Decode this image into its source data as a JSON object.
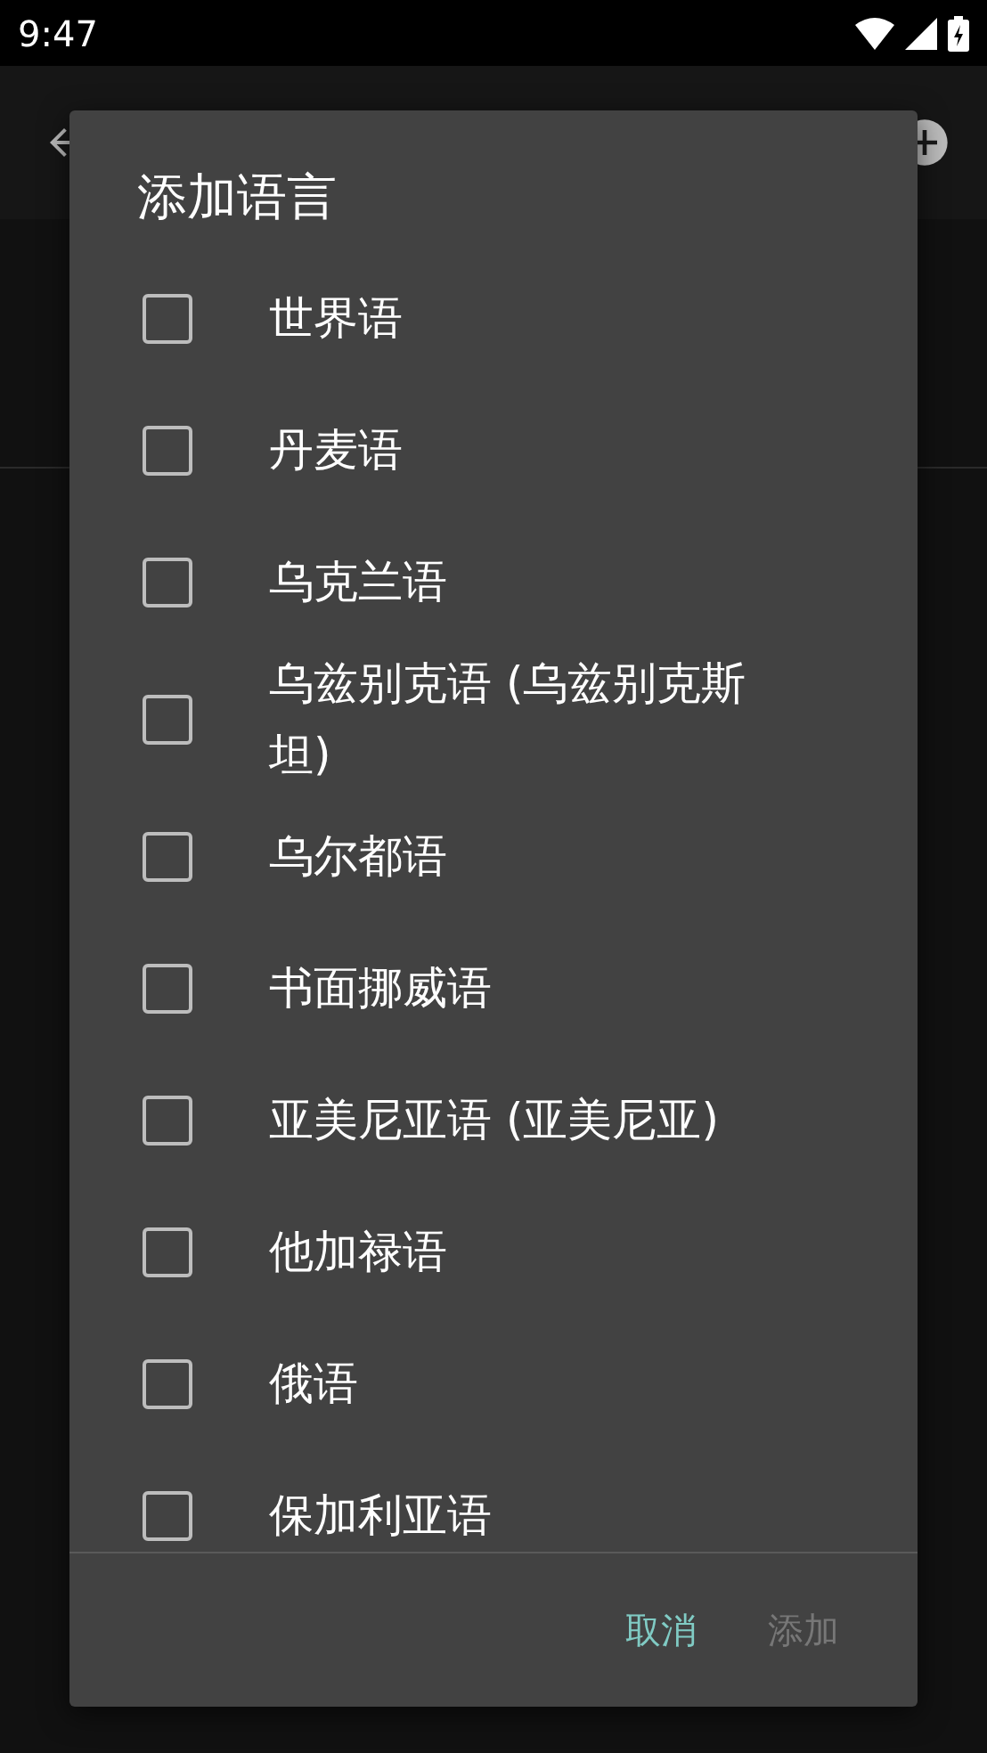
{
  "status_bar": {
    "time": "9:47"
  },
  "dialog": {
    "title": "添加语言",
    "items": [
      {
        "label": "世界语",
        "checked": false
      },
      {
        "label": "丹麦语",
        "checked": false
      },
      {
        "label": "乌克兰语",
        "checked": false
      },
      {
        "label": "乌兹别克语 (乌兹别克斯坦)",
        "checked": false
      },
      {
        "label": "乌尔都语",
        "checked": false
      },
      {
        "label": "书面挪威语",
        "checked": false
      },
      {
        "label": "亚美尼亚语 (亚美尼亚)",
        "checked": false
      },
      {
        "label": "他加禄语",
        "checked": false
      },
      {
        "label": "俄语",
        "checked": false
      },
      {
        "label": "保加利亚语",
        "checked": false
      }
    ],
    "buttons": [
      {
        "label": "取消",
        "disabled": false
      },
      {
        "label": "添加",
        "disabled": true
      }
    ]
  }
}
